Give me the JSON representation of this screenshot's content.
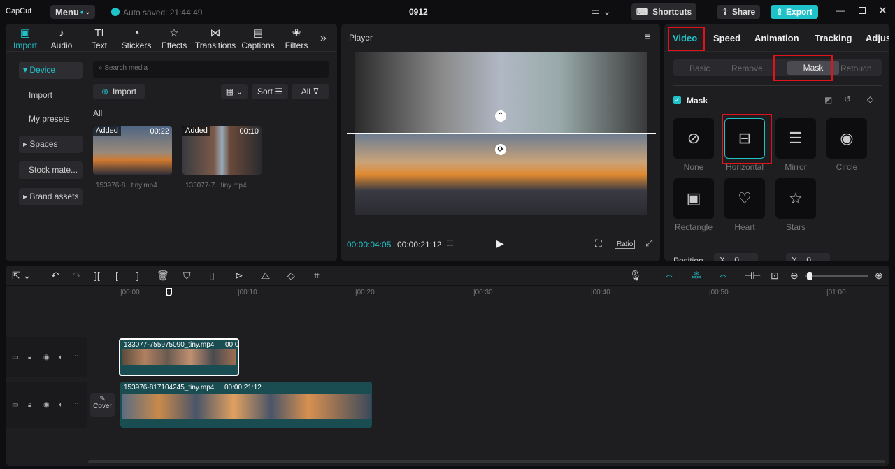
{
  "app": {
    "logo": "CapCut",
    "menu": "Menu",
    "autosave": "Auto saved: 21:44:49",
    "title": "0912",
    "shortcuts": "Shortcuts",
    "share": "Share",
    "export": "Export"
  },
  "media_tabs": [
    {
      "label": "Import",
      "icon": "import-icon"
    },
    {
      "label": "Audio",
      "icon": "audio-icon"
    },
    {
      "label": "Text",
      "icon": "text-icon"
    },
    {
      "label": "Stickers",
      "icon": "stickers-icon"
    },
    {
      "label": "Effects",
      "icon": "effects-icon"
    },
    {
      "label": "Transitions",
      "icon": "transitions-icon"
    },
    {
      "label": "Captions",
      "icon": "captions-icon"
    },
    {
      "label": "Filters",
      "icon": "filters-icon"
    }
  ],
  "sidebar": [
    "Device",
    "Import",
    "My presets",
    "Spaces",
    "Stock mate...",
    "Brand assets"
  ],
  "media": {
    "search_placeholder": "Search media",
    "import": "Import",
    "sort": "Sort",
    "all": "All",
    "section": "All",
    "items": [
      {
        "badge": "Added",
        "duration": "00:22",
        "name": "153976-8...tiny.mp4"
      },
      {
        "badge": "Added",
        "duration": "00:10",
        "name": "133077-7...tiny.mp4"
      }
    ]
  },
  "player": {
    "title": "Player",
    "current": "00:00:04:05",
    "total": "00:00:21:12",
    "ratio": "Ratio"
  },
  "right": {
    "tabs": [
      "Video",
      "Speed",
      "Animation",
      "Tracking",
      "Adjus"
    ],
    "subtabs": [
      "Basic",
      "Remove ...",
      "Mask",
      "Retouch"
    ],
    "mask_title": "Mask",
    "masks": [
      "None",
      "Horizontal",
      "Mirror",
      "Circle",
      "Rectangle",
      "Heart",
      "Stars"
    ],
    "position_label": "Position",
    "x_label": "X",
    "x_val": "0",
    "y_label": "Y",
    "y_val": "0"
  },
  "timeline": {
    "ticks": [
      "00:00",
      "00:10",
      "00:20",
      "00:30",
      "00:40",
      "00:50",
      "01:00"
    ],
    "clip1": {
      "name": "133077-755975090_tiny.mp4",
      "dur": "00:0"
    },
    "clip2": {
      "name": "153976-817104245_tiny.mp4",
      "dur": "00:00:21:12"
    },
    "cover": "Cover"
  }
}
